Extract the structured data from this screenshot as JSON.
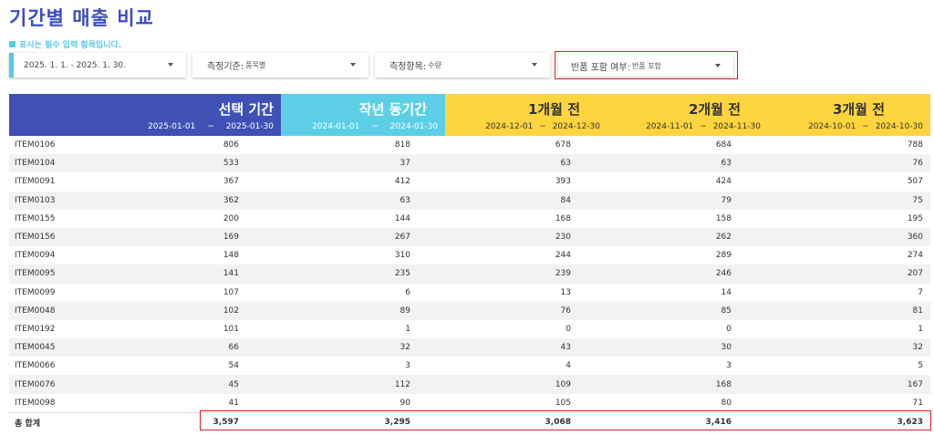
{
  "page": {
    "title": "기간별 매출 비교",
    "note": "표시는 필수 입력 항목입니다."
  },
  "filters": {
    "date_range": "2025. 1. 1. - 2025. 1. 30.",
    "criteria_label": "측정기준:",
    "criteria_value": "품목별",
    "item_label": "측정항목:",
    "item_value": "수량",
    "returns_label": "반품 포함 여부:",
    "returns_value": "반품 포함"
  },
  "header": {
    "selected": {
      "title": "선택 기간",
      "start": "2025-01-01",
      "sep": "~",
      "end": "2025-01-30",
      "color": "#3f51b5"
    },
    "last_year": {
      "title": "작년 동기간",
      "start": "2024-01-01",
      "sep": "~",
      "end": "2024-01-30",
      "color": "#5ccfe6"
    },
    "m1": {
      "title": "1개월 전",
      "start": "2024-12-01",
      "sep": "~",
      "end": "2024-12-30",
      "color": "#fdd53f"
    },
    "m2": {
      "title": "2개월 전",
      "start": "2024-11-01",
      "sep": "~",
      "end": "2024-11-30",
      "color": "#fdd53f"
    },
    "m3": {
      "title": "3개월 전",
      "start": "2024-10-01",
      "sep": "~",
      "end": "2024-10-30",
      "color": "#fdd53f"
    }
  },
  "rows": [
    [
      "ITEM0106",
      "806",
      "818",
      "678",
      "684",
      "788"
    ],
    [
      "ITEM0104",
      "533",
      "37",
      "63",
      "63",
      "76"
    ],
    [
      "ITEM0091",
      "367",
      "412",
      "393",
      "424",
      "507"
    ],
    [
      "ITEM0103",
      "362",
      "63",
      "84",
      "79",
      "75"
    ],
    [
      "ITEM0155",
      "200",
      "144",
      "168",
      "158",
      "195"
    ],
    [
      "ITEM0156",
      "169",
      "267",
      "230",
      "262",
      "360"
    ],
    [
      "ITEM0094",
      "148",
      "310",
      "244",
      "289",
      "274"
    ],
    [
      "ITEM0095",
      "141",
      "235",
      "239",
      "246",
      "207"
    ],
    [
      "ITEM0099",
      "107",
      "6",
      "13",
      "14",
      "7"
    ],
    [
      "ITEM0048",
      "102",
      "89",
      "76",
      "85",
      "81"
    ],
    [
      "ITEM0192",
      "101",
      "1",
      "0",
      "0",
      "1"
    ],
    [
      "ITEM0045",
      "66",
      "32",
      "43",
      "30",
      "32"
    ],
    [
      "ITEM0066",
      "54",
      "3",
      "4",
      "3",
      "5"
    ],
    [
      "ITEM0076",
      "45",
      "112",
      "109",
      "168",
      "167"
    ],
    [
      "ITEM0098",
      "41",
      "90",
      "105",
      "80",
      "71"
    ]
  ],
  "total": {
    "label": "총 합계",
    "values": [
      "3,597",
      "3,295",
      "3,068",
      "3,416",
      "3,623"
    ]
  }
}
